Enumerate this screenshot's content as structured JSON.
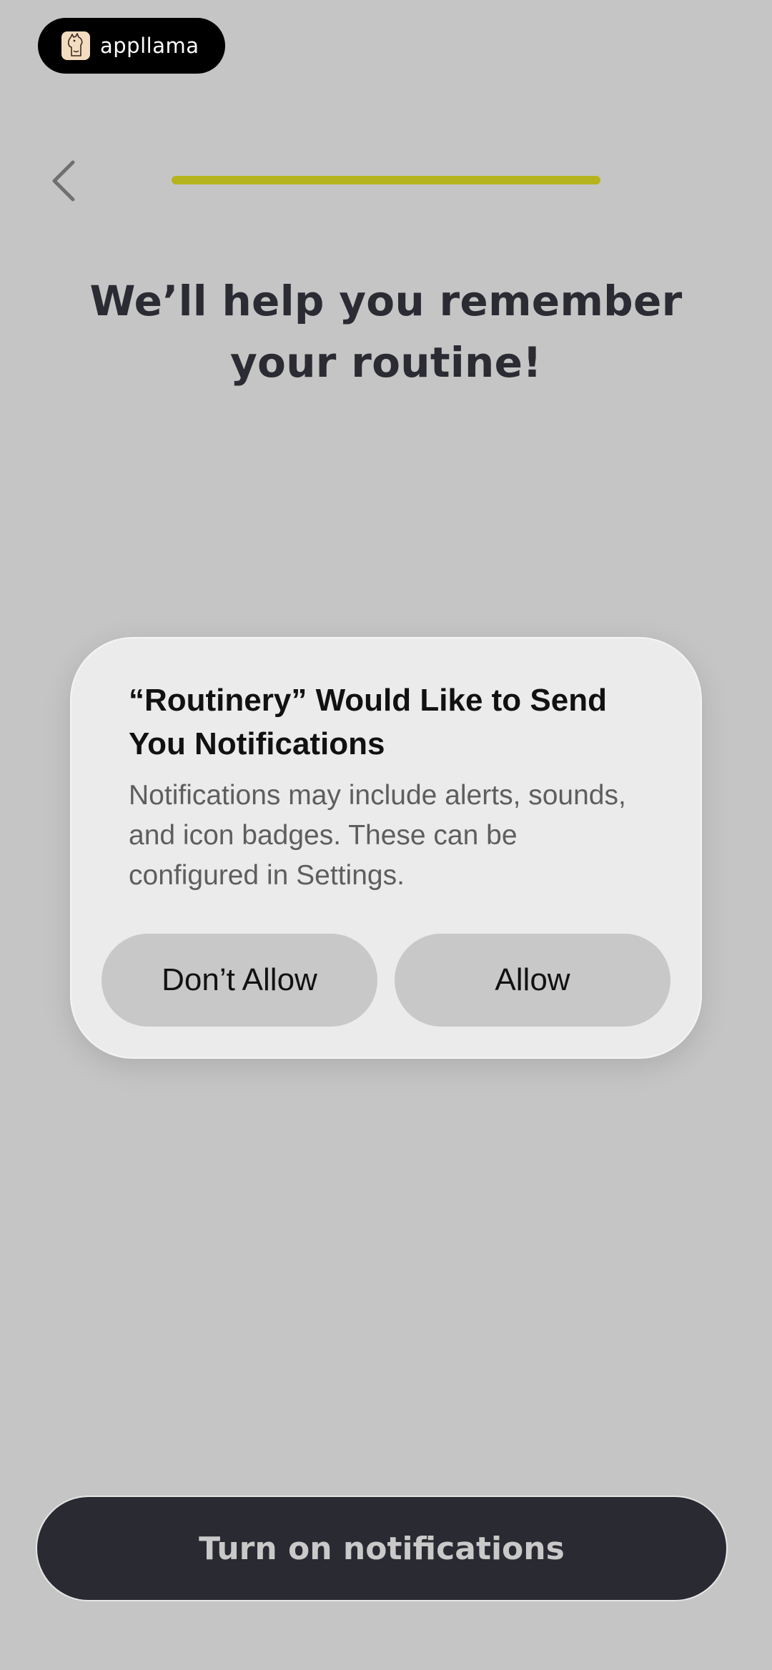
{
  "brand": {
    "name": "appllama",
    "logo_icon": "llama-icon"
  },
  "nav": {
    "back_icon": "chevron-left-icon"
  },
  "progress": {
    "value": 1.0,
    "color": "#b6b41e"
  },
  "heading": {
    "line1": "We’ll help you remember",
    "line2": "your routine!"
  },
  "dialog": {
    "title": "“Routinery” Would Like to Send You Notifications",
    "message": "Notifications may include alerts, sounds, and icon badges. These can be configured in Settings.",
    "dont_allow_label": "Don’t Allow",
    "allow_label": "Allow"
  },
  "cta": {
    "label": "Turn on notifications"
  },
  "colors": {
    "background": "#c5c5c5",
    "cta_bg": "#2a2a33",
    "dialog_bg": "#ebebeb",
    "accent": "#b6b41e"
  }
}
